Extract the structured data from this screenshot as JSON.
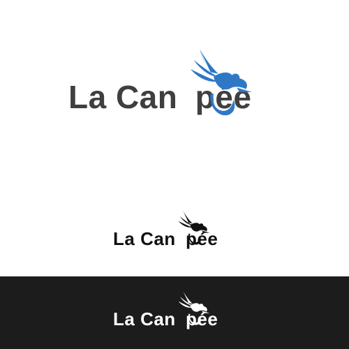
{
  "logo": {
    "brand_part1": "La Can",
    "brand_part2": "pée"
  },
  "colors": {
    "text_gray": "#3f3f3f",
    "text_black": "#111111",
    "text_white": "#ffffff",
    "bird_blue": "#2f78c6",
    "bird_black": "#111111",
    "bird_white": "#ffffff",
    "dark_band": "#1c1c1c"
  },
  "variants": [
    {
      "name": "large-blue"
    },
    {
      "name": "small-black"
    },
    {
      "name": "dark-white"
    }
  ],
  "icons": [
    "bird-icon"
  ]
}
